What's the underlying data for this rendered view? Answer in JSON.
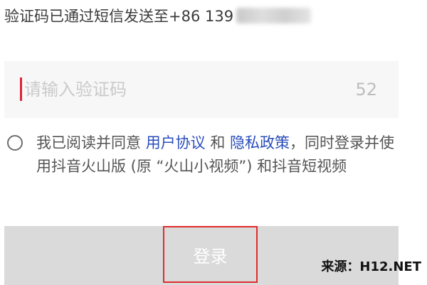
{
  "verification": {
    "sent_prefix": "验证码已通过短信发送至+86 139",
    "code_placeholder": "请输入验证码",
    "code_value": "",
    "countdown": "52"
  },
  "agreement": {
    "text_before": "我已阅读并同意 ",
    "user_agreement_link": "用户协议",
    "and_word": " 和 ",
    "privacy_policy_link": "隐私政策",
    "text_after": "，同时登录并使用抖音火山版 (原 “火山小视频”) 和抖音短视频",
    "checked": false
  },
  "login": {
    "button_label": "登录"
  },
  "watermark": {
    "text": "来源：H12.NET"
  },
  "colors": {
    "caret": "#e0213c",
    "link": "#2a4dbb",
    "highlight_border": "#e02c2c",
    "button_bg": "#dadada",
    "input_bg": "#f7f7f7"
  }
}
